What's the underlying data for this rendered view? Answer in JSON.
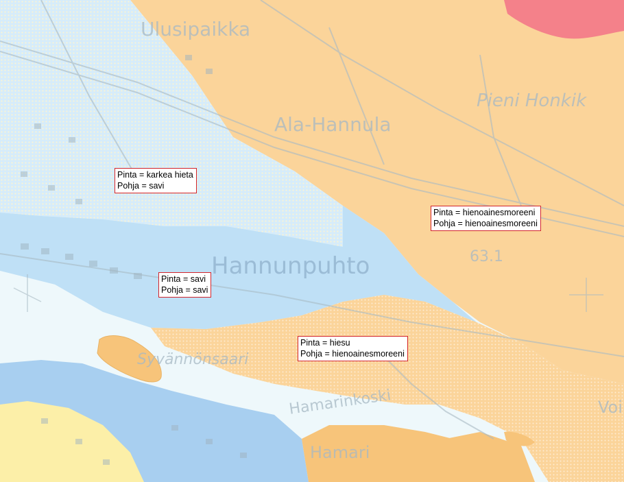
{
  "map": {
    "colors": {
      "moraine": "#fbd49a",
      "clay": "#bfe0f6",
      "clay_dark": "#a8cff0",
      "coarse_fine_sand": "#d6ecfa",
      "water": "#eef8fb",
      "bedrock": "#f4818a",
      "sand": "#fcefa8",
      "gravel_islet": "#f7c47a",
      "topo_lines": "#a9bac4"
    },
    "place_names": [
      "Ulusipaikka",
      "Ala-Hannula",
      "Pieni Honkik",
      "Hannunpuhto",
      "Syvännönsaari",
      "Hamarinkoski",
      "Hamari",
      "Voi",
      "63.1"
    ],
    "labels": [
      {
        "surface": "Pinta = karkea hieta",
        "base": "Pohja = savi"
      },
      {
        "surface": "Pinta = hienoainesmoreeni",
        "base": "Pohja = hienoainesmoreeni"
      },
      {
        "surface": "Pinta = savi",
        "base": "Pohja = savi"
      },
      {
        "surface": "Pinta = hiesu",
        "base": "Pohja = hienoainesmoreeni"
      }
    ]
  }
}
